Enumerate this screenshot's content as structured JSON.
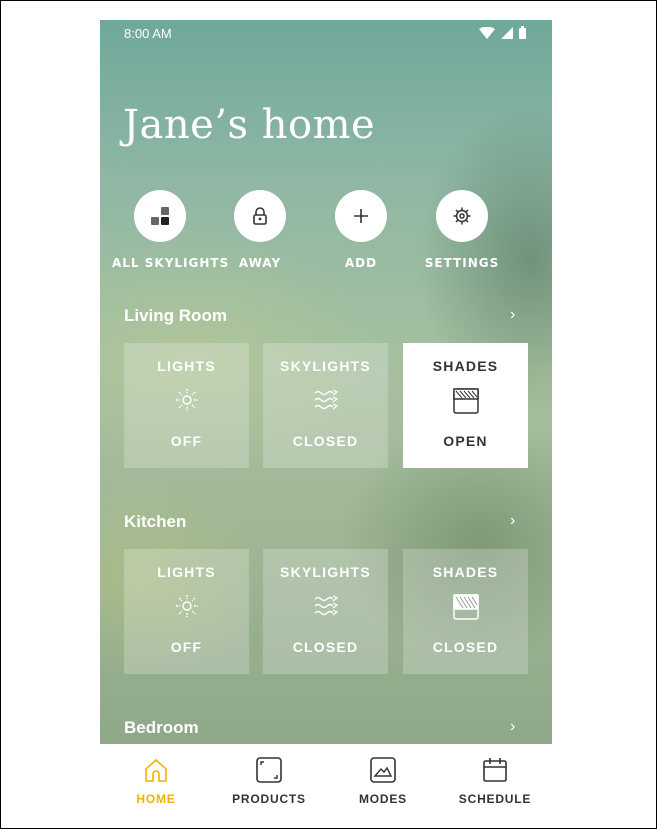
{
  "status": {
    "time": "8:00 AM"
  },
  "home": {
    "title": "Jane’s home"
  },
  "actions": [
    {
      "label": "ALL SKYLIGHTS",
      "icon": "grid-squares-icon"
    },
    {
      "label": "AWAY",
      "icon": "lock-icon"
    },
    {
      "label": "ADD",
      "icon": "plus-icon"
    },
    {
      "label": "SETTINGS",
      "icon": "gear-icon"
    }
  ],
  "rooms": [
    {
      "name": "Living Room",
      "chevron": "›",
      "tiles": [
        {
          "label": "LIGHTS",
          "state": "OFF",
          "icon": "sun-icon",
          "active": false
        },
        {
          "label": "SKYLIGHTS",
          "state": "CLOSED",
          "icon": "wind-icon",
          "active": false
        },
        {
          "label": "SHADES",
          "state": "OPEN",
          "icon": "shade-icon",
          "active": true
        }
      ]
    },
    {
      "name": "Kitchen",
      "chevron": "›",
      "tiles": [
        {
          "label": "LIGHTS",
          "state": "OFF",
          "icon": "sun-icon",
          "active": false
        },
        {
          "label": "SKYLIGHTS",
          "state": "CLOSED",
          "icon": "wind-icon",
          "active": false
        },
        {
          "label": "SHADES",
          "state": "CLOSED",
          "icon": "shade-icon",
          "active": false
        }
      ]
    },
    {
      "name": "Bedroom",
      "chevron": "›"
    }
  ],
  "tabs": [
    {
      "label": "HOME",
      "icon": "house-icon",
      "active": true
    },
    {
      "label": "PRODUCTS",
      "icon": "frame-icon",
      "active": false
    },
    {
      "label": "MODES",
      "icon": "mountain-icon",
      "active": false
    },
    {
      "label": "SCHEDULE",
      "icon": "calendar-icon",
      "active": false
    }
  ],
  "colors": {
    "accent": "#f2b200",
    "tile_active_bg": "#ffffff"
  }
}
